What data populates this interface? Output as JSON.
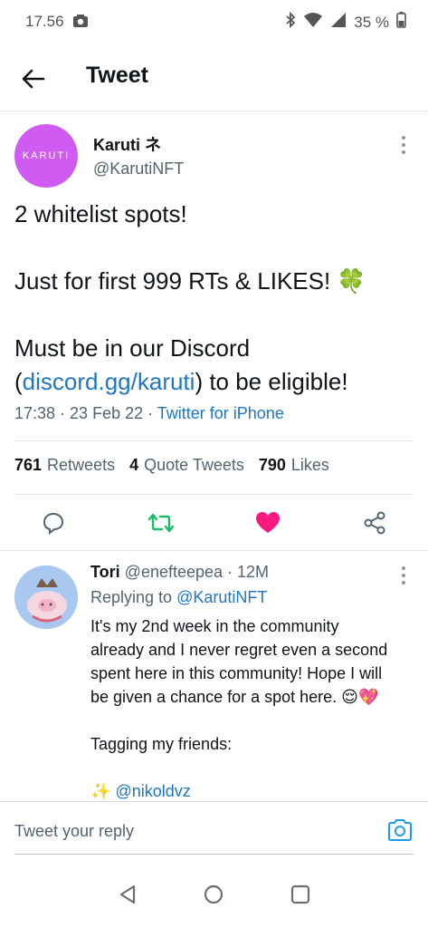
{
  "status_bar": {
    "time": "17.56",
    "battery": "35 %"
  },
  "header": {
    "title": "Tweet"
  },
  "tweet": {
    "avatar_text": "KARUTI",
    "author_name": "Karuti ネ",
    "author_handle": "@KarutiNFT",
    "text": {
      "line1": "2 whitelist spots!",
      "line2": "Just for first 999 RTs & LIKES! 🍀",
      "line3": "Must be in our Discord",
      "line4_open": "(",
      "line4_link": "discord.gg/karuti",
      "line4_rest": ") to be eligible!"
    },
    "time": "17:38 · 23 Feb 22 · ",
    "source": "Twitter for iPhone",
    "stats": {
      "retweets_count": "761",
      "retweets_label": "Retweets",
      "quotes_count": "4",
      "quotes_label": "Quote Tweets",
      "likes_count": "790",
      "likes_label": "Likes"
    },
    "colors": {
      "retweet": "#17bf63",
      "like": "#f91880",
      "link": "#1d77c4"
    }
  },
  "reply": {
    "name": "Tori",
    "handle_time": " @enefteepea · 12M",
    "replying_prefix": "Replying to ",
    "replying_handle": "@KarutiNFT",
    "lines": [
      "It's my 2nd week in the community",
      "already and I never regret even a second",
      "spent here in this community! Hope I will",
      "be given a chance for a spot here. 😌💖",
      "",
      "Tagging my friends:",
      ""
    ],
    "mention_emoji": "✨",
    "mention": "@nikoldvz"
  },
  "compose": {
    "placeholder": "Tweet your reply"
  }
}
